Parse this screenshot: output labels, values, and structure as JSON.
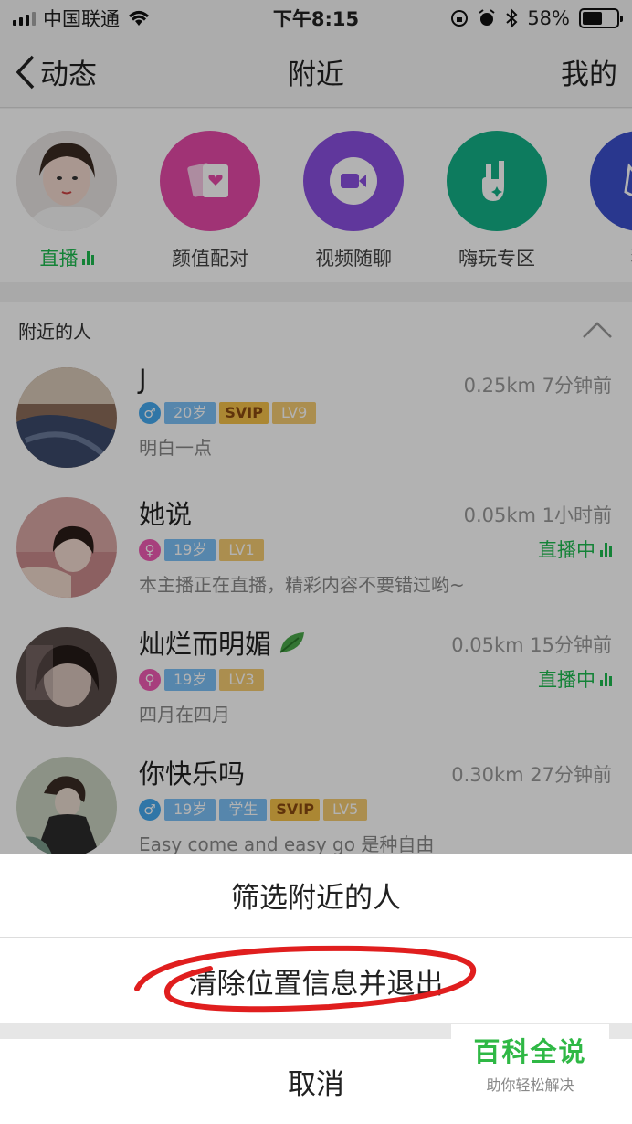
{
  "status_bar": {
    "carrier": "中国联通",
    "time": "下午8:15",
    "battery": "58%",
    "battery_level": 0.58
  },
  "nav": {
    "back_label": "动态",
    "title": "附近",
    "right_label": "我的"
  },
  "features": [
    {
      "label": "直播",
      "icon": "live-avatar",
      "color": "#e8e8e8"
    },
    {
      "label": "颜值配对",
      "icon": "heart-card-icon",
      "color": "#e64aa8"
    },
    {
      "label": "视频随聊",
      "icon": "video-chat-icon",
      "color": "#8a4fe0"
    },
    {
      "label": "嗨玩专区",
      "icon": "rock-hand-icon",
      "color": "#13b087"
    },
    {
      "label": "狼",
      "icon": "wolf-icon",
      "color": "#3b4fcc"
    }
  ],
  "section": {
    "title": "附近的人"
  },
  "users": [
    {
      "name": "J",
      "sex": "♂",
      "age": "20岁",
      "extra": "",
      "svip": "SVIP",
      "level": "LV9",
      "meta": "0.25km 7分钟前",
      "live": "",
      "signature": "明白一点"
    },
    {
      "name": "她说",
      "sex": "♀",
      "age": "19岁",
      "extra": "",
      "svip": "",
      "level": "LV1",
      "meta": "0.05km 1小时前",
      "live": "直播中",
      "signature": "本主播正在直播，精彩内容不要错过哟~"
    },
    {
      "name": "灿烂而明媚",
      "sex": "♀",
      "age": "19岁",
      "extra": "",
      "svip": "",
      "level": "LV3",
      "meta": "0.05km 15分钟前",
      "live": "直播中",
      "signature": "四月在四月"
    },
    {
      "name": "你快乐吗",
      "sex": "♂",
      "age": "19岁",
      "extra": "学生",
      "svip": "SVIP",
      "level": "LV5",
      "meta": "0.30km 27分钟前",
      "live": "",
      "signature": "Easy come and easy go 是种自由"
    }
  ],
  "sheet": {
    "filter_label": "筛选附近的人",
    "clear_label": "清除位置信息并退出",
    "cancel_label": "取消"
  },
  "watermark": {
    "title": "百科全说",
    "subtitle": "助你轻松解决"
  },
  "colors": {
    "live_green": "#1dbb4f",
    "annotation_red": "#e01e1e"
  }
}
